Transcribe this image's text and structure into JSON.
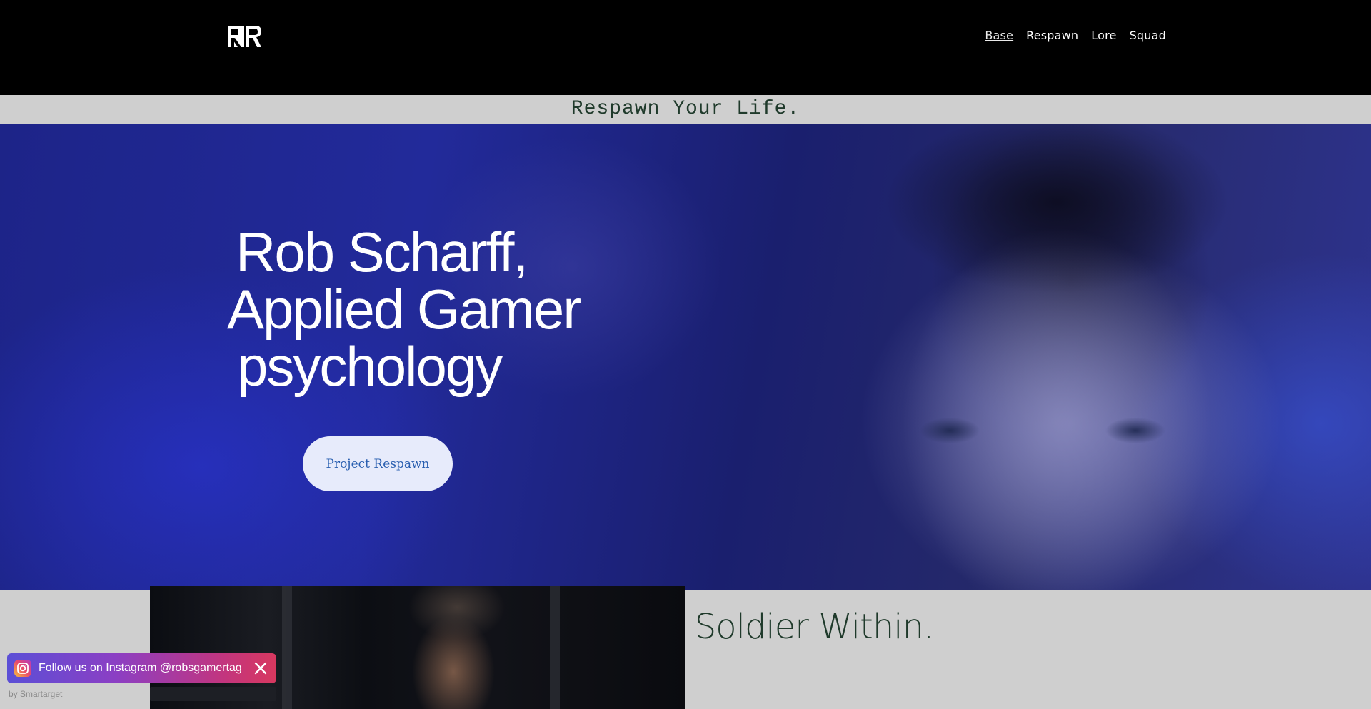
{
  "header": {
    "logo_alt": "RR",
    "nav": [
      {
        "label": "Base",
        "active": true
      },
      {
        "label": "Respawn",
        "active": false
      },
      {
        "label": "Lore",
        "active": false
      },
      {
        "label": "Squad",
        "active": false
      }
    ]
  },
  "tagline": "Respawn Your Life.",
  "hero": {
    "title_lines": [
      "Rob Scharff,",
      "Applied Gamer",
      "psychology"
    ],
    "cta_label": "Project Respawn"
  },
  "lower": {
    "heading": "e Soldier Within."
  },
  "toast": {
    "text": "Follow us on Instagram @robsgamertag",
    "icon": "instagram-icon",
    "close_icon": "close-icon",
    "byline": "by Smartarget"
  },
  "colors": {
    "header_bg": "#000000",
    "tagline_text": "#1f3a2b",
    "cta_bg": "#e7ebfb",
    "cta_text": "#2a5fb0"
  }
}
